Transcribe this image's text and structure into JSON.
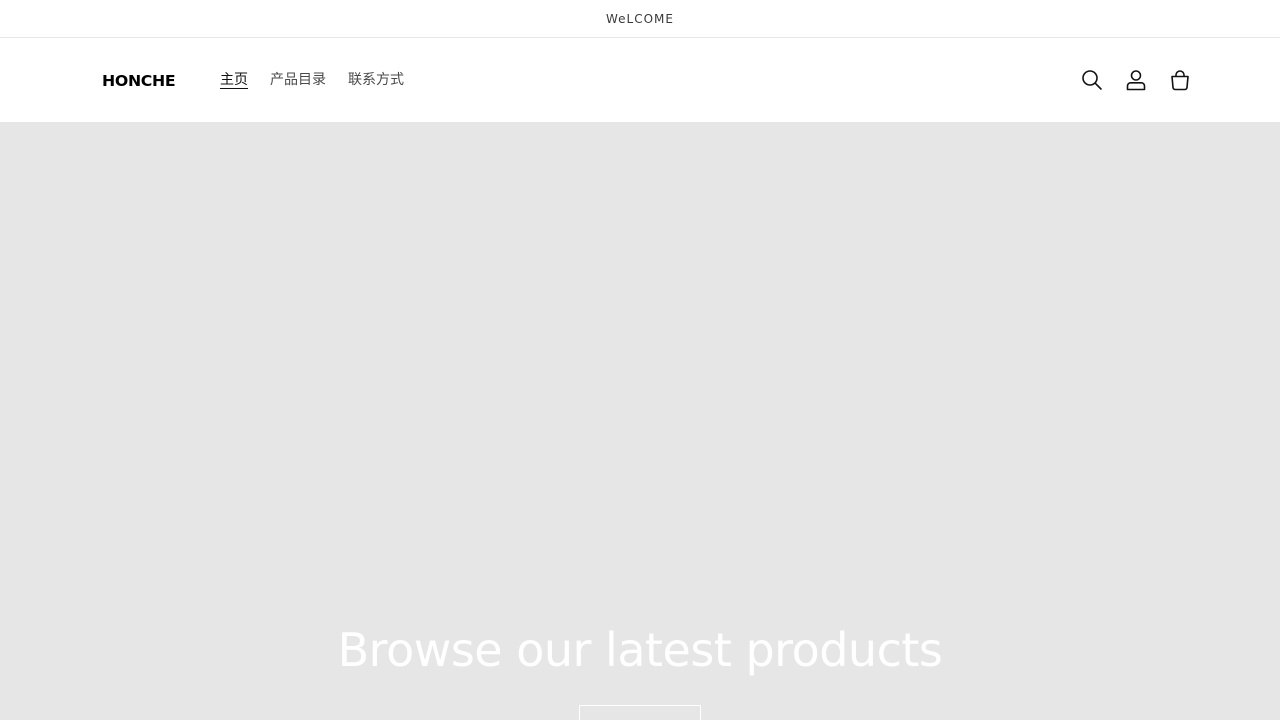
{
  "announcement": {
    "text": "WeLCOME"
  },
  "header": {
    "logo_text": "HONCHE",
    "nav": [
      {
        "label": "主页",
        "active": true
      },
      {
        "label": "产品目录",
        "active": false
      },
      {
        "label": "联系方式",
        "active": false
      }
    ],
    "icons": [
      "search-icon",
      "account-icon",
      "cart-icon"
    ]
  },
  "hero": {
    "heading": "Browse our latest products",
    "button_label": "",
    "background_color": "#e6e6e6",
    "text_color": "#ffffff"
  }
}
